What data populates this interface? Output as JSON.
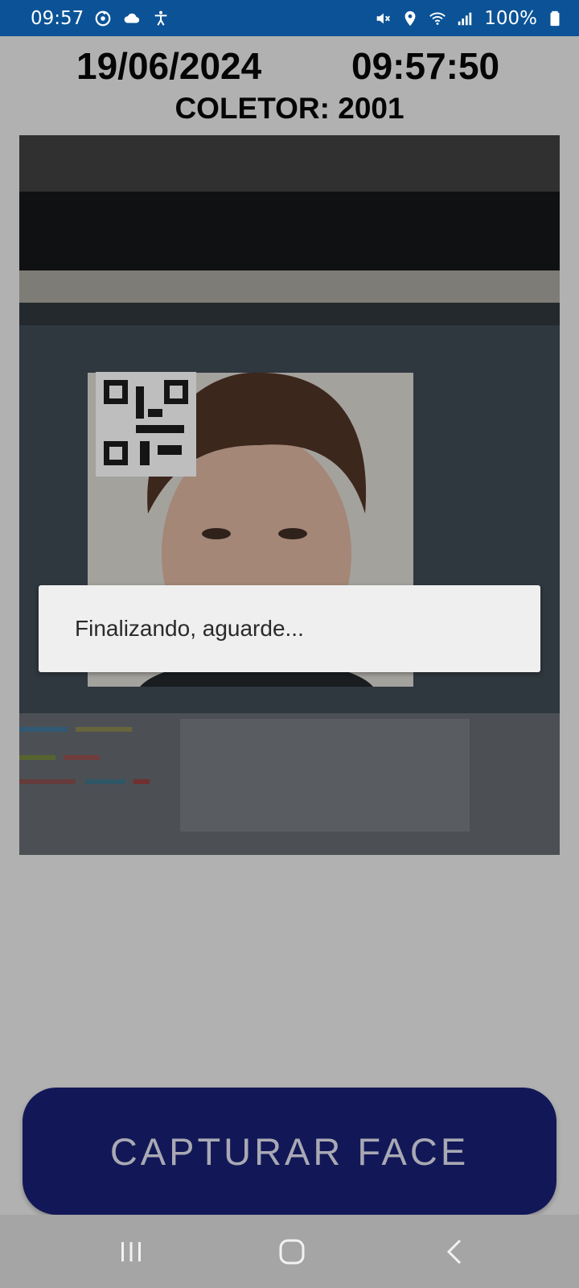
{
  "status_bar": {
    "time": "09:57",
    "battery": "100%",
    "left_icons": [
      "sync-icon",
      "cloud-icon",
      "accessibility-icon"
    ],
    "right_icons": [
      "mute-icon",
      "location-icon",
      "wifi-icon",
      "signal-icon",
      "battery-icon"
    ],
    "background": "#0b5396"
  },
  "header": {
    "date": "19/06/2024",
    "time": "09:57:50",
    "collector": "COLETOR: 2001"
  },
  "camera": {
    "icon": "camera-preview"
  },
  "dialog": {
    "message": "Finalizando, aguarde..."
  },
  "capture_button": {
    "label": "CAPTURAR FACE",
    "background": "#121857"
  },
  "nav_bar": {
    "icons": [
      "recent-apps-icon",
      "home-icon",
      "back-icon"
    ]
  }
}
